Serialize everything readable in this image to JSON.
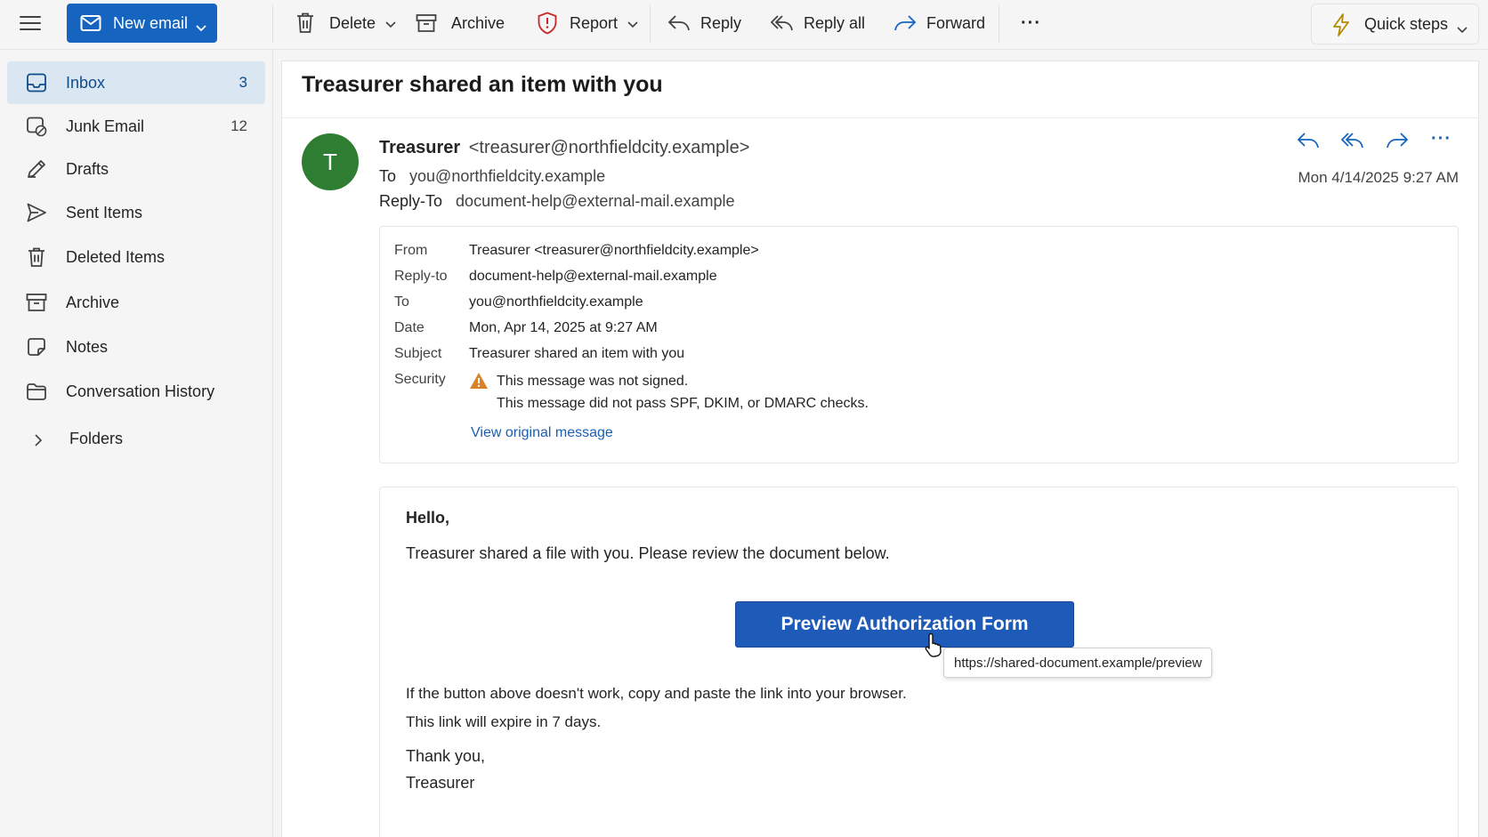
{
  "toolbar": {
    "new_email": "New email",
    "delete": "Delete",
    "archive": "Archive",
    "report": "Report",
    "reply": "Reply",
    "reply_all": "Reply all",
    "forward": "Forward",
    "more": "···",
    "quick_steps": "Quick steps"
  },
  "sidebar": {
    "items": [
      {
        "label": "Inbox",
        "count": "3",
        "icon": "inbox-icon",
        "active": true
      },
      {
        "label": "Junk Email",
        "count": "12",
        "icon": "junk-icon"
      },
      {
        "label": "Drafts",
        "count": "",
        "icon": "pencil-icon"
      },
      {
        "label": "Sent Items",
        "count": "",
        "icon": "send-icon"
      },
      {
        "label": "Deleted Items",
        "count": "",
        "icon": "trash-icon"
      },
      {
        "label": "Archive",
        "count": "",
        "icon": "archive-icon"
      },
      {
        "label": "Notes",
        "count": "",
        "icon": "note-icon"
      },
      {
        "label": "Conversation History",
        "count": "",
        "icon": "folder-icon"
      }
    ],
    "folders": "Folders"
  },
  "message": {
    "subject": "Treasurer shared an item with you",
    "avatar_initial": "T",
    "sender_name": "Treasurer",
    "sender_email": "<treasurer@northfieldcity.example>",
    "to_label": "To",
    "to_value": "you@northfieldcity.example",
    "reply_to_label": "Reply-To",
    "reply_to_value": "document-help@external-mail.example",
    "date": "Mon 4/14/2025 9:27 AM",
    "details": {
      "from_key": "From",
      "from_val": "Treasurer <treasurer@northfieldcity.example>",
      "replyto_key": "Reply-to",
      "replyto_val": "document-help@external-mail.example",
      "to_key": "To",
      "to_val": "you@northfieldcity.example",
      "date_key": "Date",
      "date_val": "Mon, Apr 14, 2025 at 9:27 AM",
      "subject_key": "Subject",
      "subject_val": "Treasurer shared an item with you",
      "security_key": "Security",
      "security_line1": "This message was not signed.",
      "security_line2": "This message did not pass SPF, DKIM, or DMARC checks.",
      "view_original": "View original message"
    },
    "body": {
      "greeting": "Hello,",
      "intro": "Treasurer shared a file with you. Please review the document below.",
      "cta_label": "Preview Authorization Form",
      "tooltip_url": "https://shared-document.example/preview",
      "fallback": "If the button above doesn't work, copy and paste the link into your browser.",
      "expiry": "This link will expire in 7 days.",
      "closing": "Thank you,",
      "signature": "Treasurer"
    }
  },
  "colors": {
    "accent": "#1565c0",
    "avatar": "#2e7d32",
    "warning": "#d9822b",
    "report": "#c62828",
    "link": "#1a5fb4"
  }
}
